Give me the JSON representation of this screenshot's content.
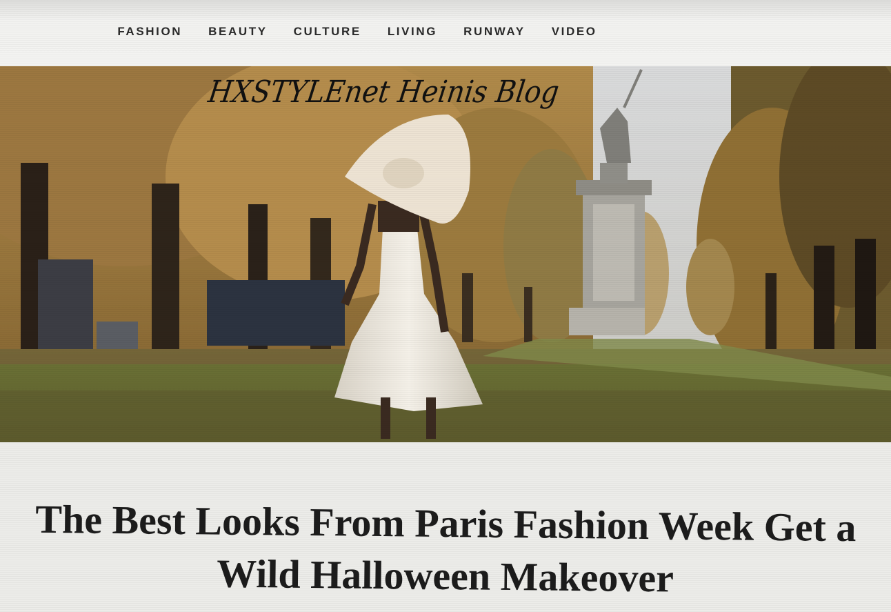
{
  "nav": {
    "items": [
      "FASHION",
      "BEAUTY",
      "CULTURE",
      "LIVING",
      "RUNWAY",
      "VIDEO"
    ]
  },
  "hero": {
    "watermark": "HXSTYLEnet Heinis Blog"
  },
  "article": {
    "headline_line1": "The Best Looks From Paris Fashion Week Get a",
    "headline_line2": "Wild Halloween Makeover"
  },
  "colors": {
    "nav_text": "#2a2a2a",
    "headline_text": "#1c1c1c",
    "background": "#ecece9"
  }
}
